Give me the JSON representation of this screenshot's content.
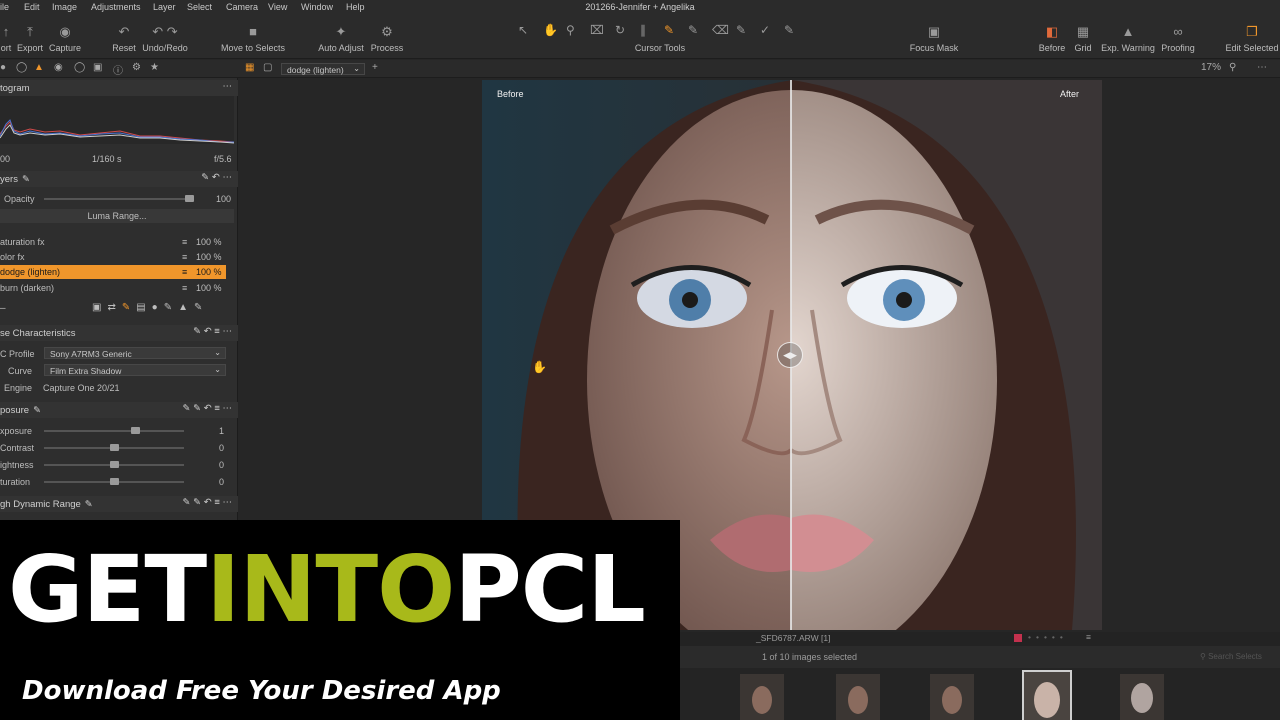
{
  "window": {
    "title": "201266-Jennifer + Angelika"
  },
  "menu": [
    "File",
    "Edit",
    "Image",
    "Adjustments",
    "Layer",
    "Select",
    "Camera",
    "View",
    "Window",
    "Help"
  ],
  "menu_visible": [
    "ile",
    "Edit",
    "Image",
    "Adjustments",
    "Layer",
    "Select",
    "Camera",
    "View",
    "Window",
    "Help"
  ],
  "toolbar": {
    "import_label": "ort",
    "export_label": "Export",
    "capture_label": "Capture",
    "reset_label": "Reset",
    "undoredo_label": "Undo/Redo",
    "move_label": "Move to Selects",
    "autoadjust_label": "Auto Adjust",
    "process_label": "Process",
    "cursor_label": "Cursor Tools",
    "focusmask_label": "Focus Mask",
    "before_label": "Before",
    "grid_label": "Grid",
    "expwarn_label": "Exp. Warning",
    "proofing_label": "Proofing",
    "editselected_label": "Edit Selected"
  },
  "subbar": {
    "layer_select": "dodge (lighten)",
    "zoom": "17%"
  },
  "histogram": {
    "title": "togram",
    "iso": "00",
    "shutter": "1/160 s",
    "aperture": "f/5.6"
  },
  "layers": {
    "title": "yers",
    "opacity_label": "Opacity",
    "opacity_value": "100",
    "opacity_level": 1.0,
    "luma_label": "Luma Range...",
    "items": [
      {
        "name": "aturation fx",
        "value": "100 %",
        "selected": false
      },
      {
        "name": "olor fx",
        "value": "100 %",
        "selected": false
      },
      {
        "name": "dodge (lighten)",
        "value": "100 %",
        "selected": true
      },
      {
        "name": "burn (darken)",
        "value": "100 %",
        "selected": false
      }
    ]
  },
  "base": {
    "title": "se Characteristics",
    "icc_label": "C Profile",
    "icc_value": "Sony A7RM3 Generic",
    "curve_label": "Curve",
    "curve_value": "Film Extra Shadow",
    "engine_label": "Engine",
    "engine_value": "Capture One 20/21"
  },
  "exposure": {
    "title": "posure",
    "sliders": [
      {
        "label": "xposure",
        "value": "1",
        "level": 0.65
      },
      {
        "label": "Contrast",
        "value": "0",
        "level": 0.5
      },
      {
        "label": "ightness",
        "value": "0",
        "level": 0.5
      },
      {
        "label": "turation",
        "value": "0",
        "level": 0.5
      }
    ]
  },
  "hdr": {
    "title": "gh Dynamic Range"
  },
  "viewer": {
    "before": "Before",
    "after": "After"
  },
  "filmstrip": {
    "filename": "_SFD6787.ARW [1]",
    "count": "1 of 10 images selected",
    "search_placeholder": "Search Selects"
  },
  "watermark": {
    "part1": "GET",
    "part2": "INTO",
    "part3": "PCL",
    "tagline": "Download Free Your Desired App",
    "color_white": "#ffffff",
    "color_green": "#a8b91a"
  }
}
